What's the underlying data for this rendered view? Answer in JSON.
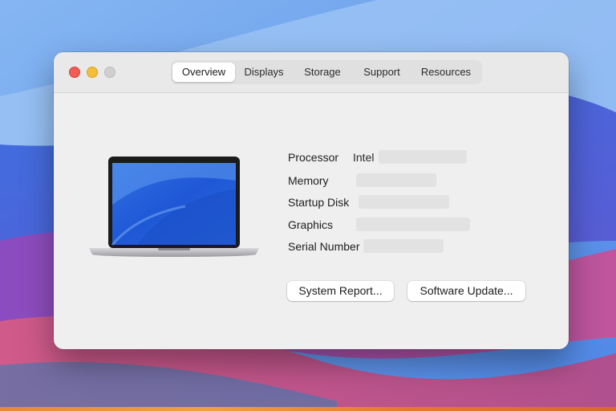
{
  "window": {
    "tabs": [
      {
        "label": "Overview",
        "active": true
      },
      {
        "label": "Displays",
        "active": false
      },
      {
        "label": "Storage",
        "active": false
      },
      {
        "label": "Support",
        "active": false
      },
      {
        "label": "Resources",
        "active": false
      }
    ]
  },
  "specs": {
    "processor_label": "Processor",
    "processor_value_prefix": "Intel",
    "memory_label": "Memory",
    "startup_disk_label": "Startup Disk",
    "graphics_label": "Graphics",
    "serial_number_label": "Serial Number"
  },
  "buttons": {
    "system_report": "System Report...",
    "software_update": "Software Update..."
  },
  "colors": {
    "close": "#ee5e55",
    "minimize": "#f4bd3a",
    "zoom_disabled": "#cfcfcf",
    "window_bg": "#efefef",
    "desktop_blue": "#3a6fd6",
    "desktop_purple": "#7a4fbf"
  }
}
